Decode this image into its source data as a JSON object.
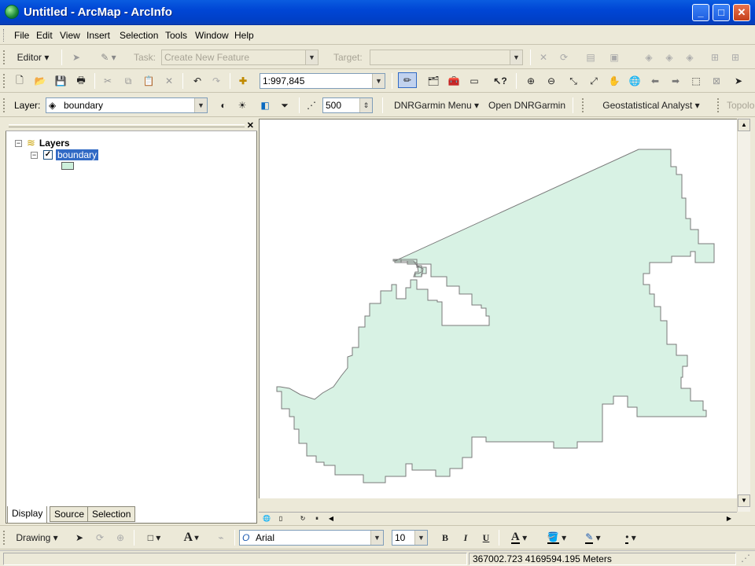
{
  "window": {
    "title": "Untitled - ArcMap - ArcInfo"
  },
  "menu": [
    "File",
    "Edit",
    "View",
    "Insert",
    "Selection",
    "Tools",
    "Window",
    "Help"
  ],
  "editor_toolbar": {
    "editor_label": "Editor",
    "task_label": "Task:",
    "task_value": "Create New Feature",
    "target_label": "Target:",
    "target_value": ""
  },
  "standard_toolbar": {
    "scale": "1:997,845"
  },
  "layer_toolbar": {
    "layer_label": "Layer:",
    "layer_value": "boundary",
    "distance_value": "500",
    "dnr_menu": "DNRGarmin Menu",
    "open_dnr": "Open DNRGarmin",
    "geostat": "Geostatistical Analyst",
    "topology": "Topolo"
  },
  "toc": {
    "root": "Layers",
    "layer": "boundary",
    "layer_checked": true,
    "swatch_color": "#cdf0dc",
    "tabs": [
      "Display",
      "Source",
      "Selection"
    ]
  },
  "map": {
    "fill": "#d8f2e4",
    "stroke": "#7a7a7a"
  },
  "drawing_toolbar": {
    "drawing_label": "Drawing",
    "font": "Arial",
    "font_size": "10",
    "bold": "B",
    "italic": "I",
    "underline": "U",
    "text_tool": "A"
  },
  "status": {
    "coords": "367002.723  4169594.195 Meters"
  }
}
